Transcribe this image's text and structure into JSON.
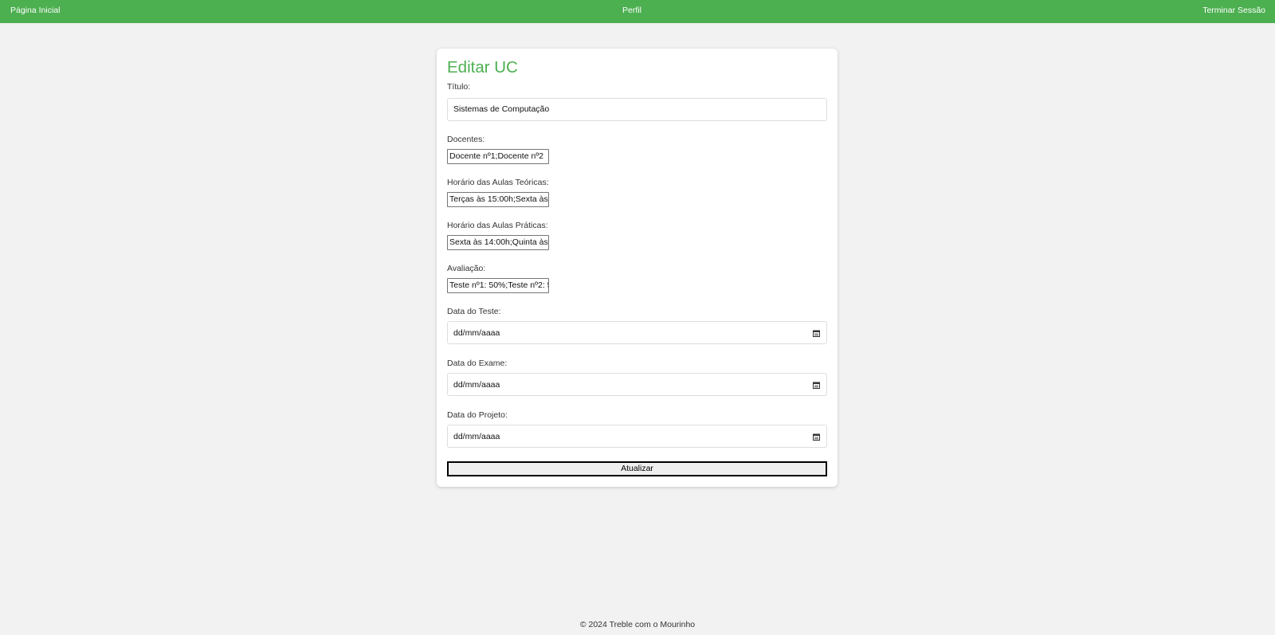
{
  "nav": {
    "home": "Página Inicial",
    "profile": "Perfil",
    "logout": "Terminar Sessão"
  },
  "form": {
    "title": "Editar UC",
    "titulo_label": "Título:",
    "titulo_value": "Sistemas de Computação",
    "docentes_label": "Docentes:",
    "docentes_value": "Docente nº1;Docente nº2",
    "teoricas_label": "Horário das Aulas Teóricas:",
    "teoricas_value": "Terças às 15:00h;Sexta às",
    "praticas_label": "Horário das Aulas Práticas:",
    "praticas_value": "Sexta às 14:00h;Quinta às",
    "avaliacao_label": "Avaliação:",
    "avaliacao_value": "Teste nº1: 50%;Teste nº2: 5",
    "teste_label": "Data do Teste:",
    "teste_placeholder": "dd/mm/aaaa",
    "exame_label": "Data do Exame:",
    "exame_placeholder": "dd/mm/aaaa",
    "projeto_label": "Data do Projeto:",
    "projeto_placeholder": "dd/mm/aaaa",
    "submit_label": "Atualizar"
  },
  "footer": {
    "text": "© 2024 Treble com o Mourinho"
  },
  "colors": {
    "accent": "#4caf50",
    "background": "#f2f2f2"
  }
}
